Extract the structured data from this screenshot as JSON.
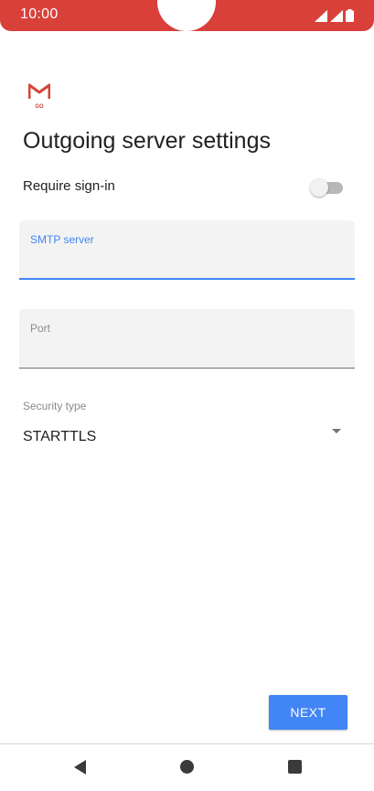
{
  "status_bar": {
    "time": "10:00",
    "background_color": "#d9403a",
    "icons": [
      "wifi-signal-icon",
      "cell-signal-icon",
      "battery-icon"
    ]
  },
  "app": {
    "logo_icon": "gmail-go-logo-icon",
    "logo_text": "GO"
  },
  "page": {
    "title": "Outgoing server settings"
  },
  "require_signin": {
    "label": "Require sign-in",
    "enabled": false
  },
  "fields": {
    "smtp_server": {
      "label": "SMTP server",
      "value": "",
      "focused": true
    },
    "port": {
      "label": "Port",
      "value": ""
    }
  },
  "security": {
    "label": "Security type",
    "selected": "STARTTLS",
    "icon": "dropdown-arrow-icon"
  },
  "actions": {
    "next_label": "NEXT",
    "accent_color": "#4285f4"
  },
  "nav_bar": {
    "icons": [
      "back-icon",
      "home-icon",
      "recent-apps-icon"
    ]
  }
}
